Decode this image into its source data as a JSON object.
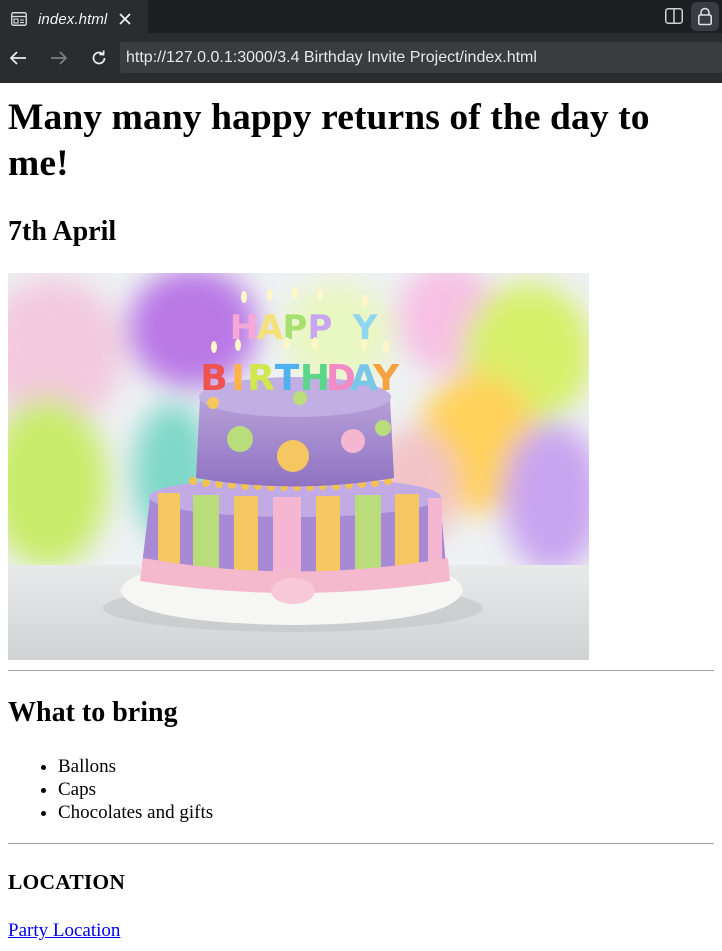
{
  "browser": {
    "tab_title": "index.html",
    "url": "http://127.0.0.1:3000/3.4 Birthday Invite Project/index.html",
    "icons": {
      "tab": "page-icon",
      "close": "close-icon",
      "split": "split-view-icon",
      "lock": "lock-icon",
      "back": "back-arrow-icon",
      "forward": "forward-arrow-icon",
      "reload": "reload-icon"
    }
  },
  "page": {
    "heading": "Many many happy returns of the day to me!",
    "date": "7th April",
    "image": {
      "cake_lettering": "HAPPY BIRTHDAY"
    },
    "bring_heading": "What to bring",
    "bring_items": [
      "Ballons",
      "Caps",
      "Chocolates and gifts"
    ],
    "location_heading": "LOCATION",
    "location_link": "Party Location"
  }
}
